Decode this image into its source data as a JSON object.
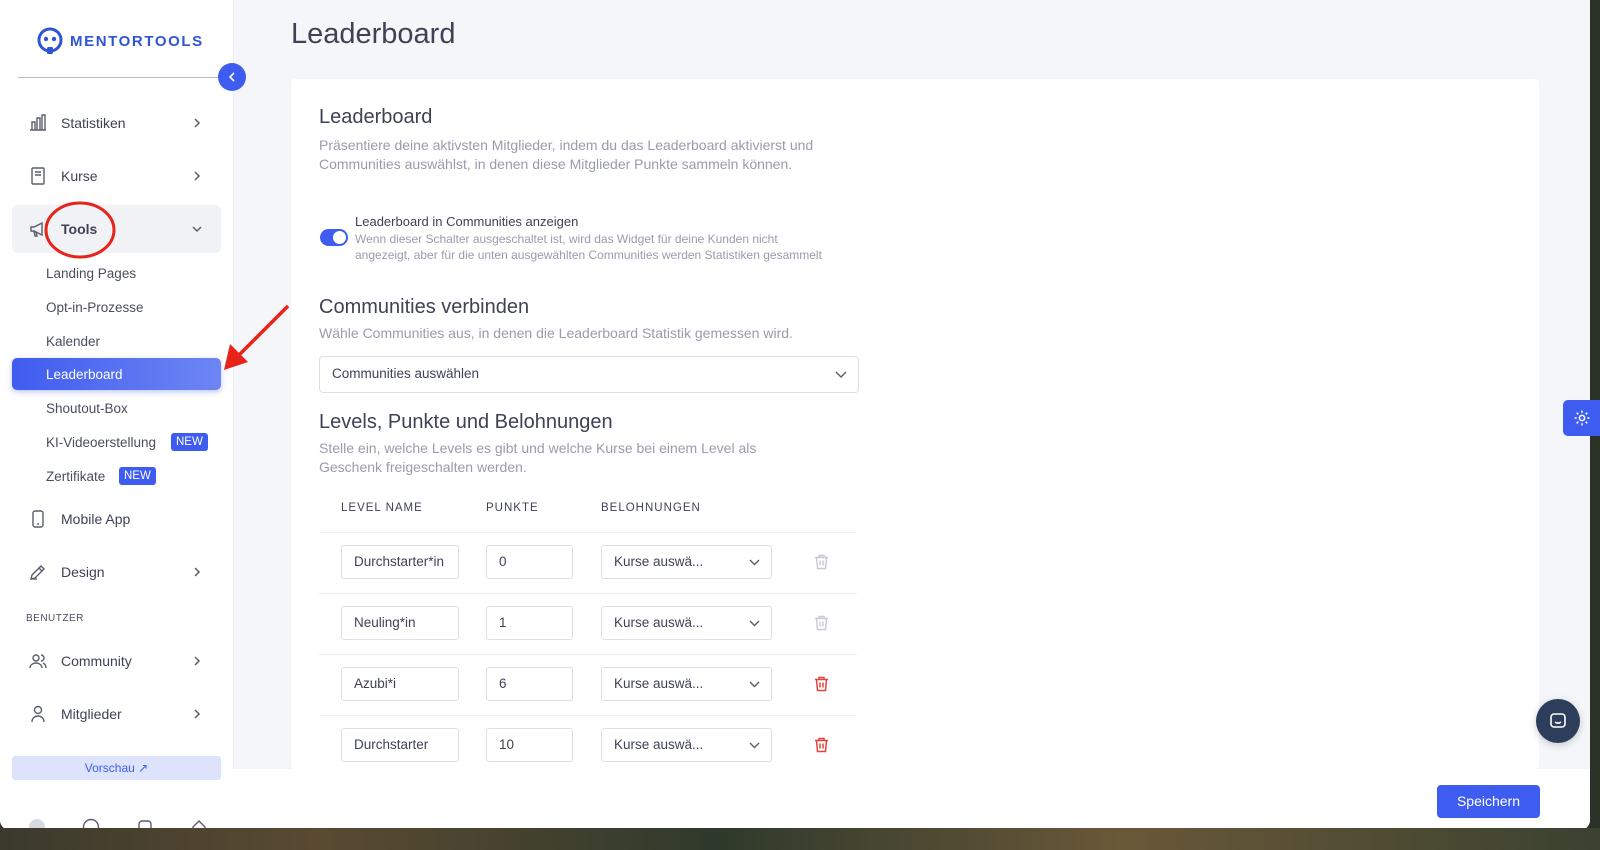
{
  "app": {
    "logo_text": "MENTORTOOLS",
    "accent": "#3e5cf0"
  },
  "sidebar": {
    "items": [
      {
        "label": "Statistiken",
        "icon": "bar-chart-icon"
      },
      {
        "label": "Kurse",
        "icon": "book-icon"
      },
      {
        "label": "Tools",
        "icon": "megaphone-icon"
      },
      {
        "label": "Mobile App",
        "icon": "phone-icon"
      },
      {
        "label": "Design",
        "icon": "pencil-icon"
      },
      {
        "label": "Community",
        "icon": "users-icon"
      },
      {
        "label": "Mitglieder",
        "icon": "user-icon"
      }
    ],
    "tools_sub": [
      {
        "label": "Landing Pages"
      },
      {
        "label": "Opt-in-Prozesse"
      },
      {
        "label": "Kalender"
      },
      {
        "label": "Leaderboard",
        "active": true
      },
      {
        "label": "Shoutout-Box"
      },
      {
        "label": "KI-Videoerstellung",
        "badge": "NEW"
      },
      {
        "label": "Zertifikate",
        "badge": "NEW"
      }
    ],
    "section_users": "BENUTZER",
    "preview_label": "Vorschau ↗"
  },
  "main": {
    "page_title": "Leaderboard",
    "section1": {
      "title": "Leaderboard",
      "description": "Präsentiere deine aktivsten Mitglieder, indem du das Leaderboard aktivierst und Communities auswählst, in denen diese Mitglieder Punkte sammeln können.",
      "toggle_label": "Leaderboard in Communities anzeigen",
      "toggle_on": true,
      "toggle_description": "Wenn dieser Schalter ausgeschaltet ist, wird das Widget für deine Kunden nicht angezeigt, aber für die unten ausgewählten Communities werden Statistiken gesammelt"
    },
    "section2": {
      "title": "Communities verbinden",
      "description": "Wähle Communities aus, in denen die Leaderboard Statistik gemessen wird.",
      "select_value": "Communities auswählen"
    },
    "section3": {
      "title": "Levels, Punkte und Belohnungen",
      "description": "Stelle ein, welche Levels es gibt und welche Kurse bei einem Level als Geschenk freigeschalten werden.",
      "columns": [
        "LEVEL NAME",
        "PUNKTE",
        "BELOHNUNGEN"
      ],
      "rows": [
        {
          "name": "Durchstarter*in",
          "points": "0",
          "reward": "Kurse auswä...",
          "deletable": false
        },
        {
          "name": "Neuling*in",
          "points": "1",
          "reward": "Kurse auswä...",
          "deletable": false
        },
        {
          "name": "Azubi*i",
          "points": "6",
          "reward": "Kurse auswä...",
          "deletable": true
        },
        {
          "name": "Durchstarter",
          "points": "10",
          "reward": "Kurse auswä...",
          "deletable": true
        }
      ]
    },
    "save_label": "Speichern"
  },
  "colors": {
    "annotation": "#e8231a",
    "delete": "#e0463c",
    "disabled": "#c8cad3"
  }
}
